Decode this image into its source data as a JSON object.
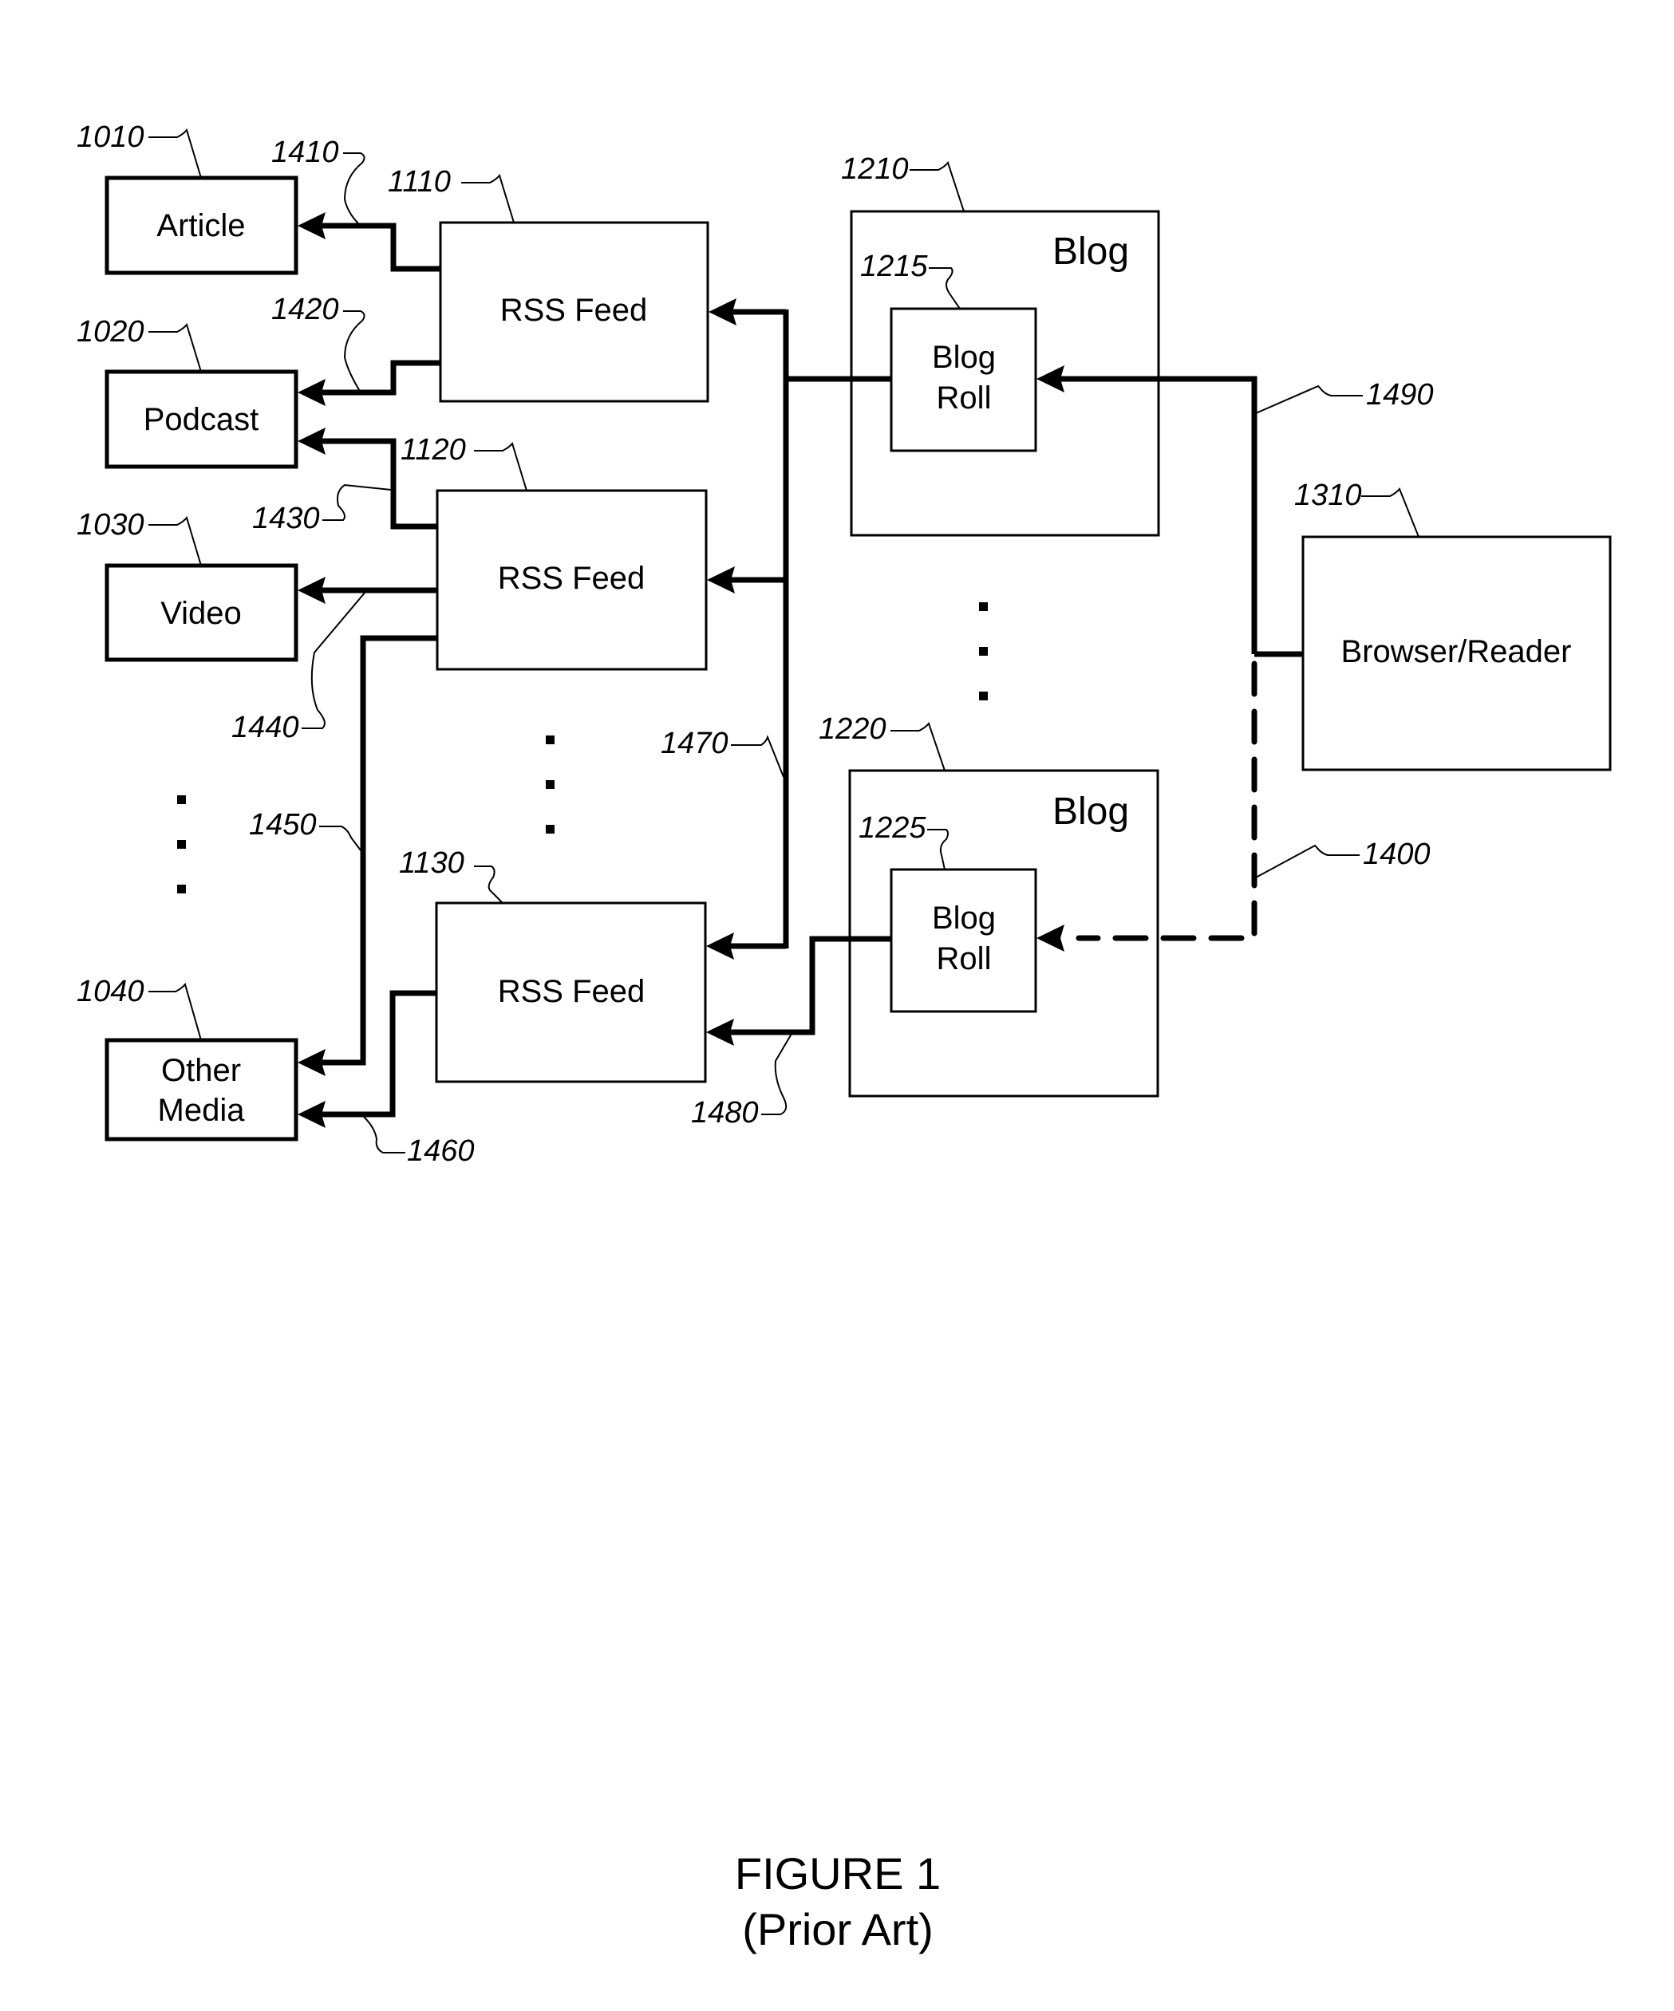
{
  "figure": {
    "title": "FIGURE 1",
    "subtitle": "(Prior Art)"
  },
  "media": {
    "article": {
      "label": "Article",
      "ref": "1010"
    },
    "podcast": {
      "label": "Podcast",
      "ref": "1020"
    },
    "video": {
      "label": "Video",
      "ref": "1030"
    },
    "other": {
      "label_line1": "Other",
      "label_line2": "Media",
      "ref": "1040"
    }
  },
  "feeds": {
    "feed1": {
      "label": "RSS Feed",
      "ref": "1110"
    },
    "feed2": {
      "label": "RSS Feed",
      "ref": "1120"
    },
    "feed3": {
      "label": "RSS Feed",
      "ref": "1130"
    }
  },
  "blogs": {
    "blog1": {
      "label": "Blog",
      "ref": "1210",
      "roll_line1": "Blog",
      "roll_line2": "Roll",
      "roll_ref": "1215"
    },
    "blog2": {
      "label": "Blog",
      "ref": "1220",
      "roll_line1": "Blog",
      "roll_line2": "Roll",
      "roll_ref": "1225"
    }
  },
  "browser": {
    "label": "Browser/Reader",
    "ref": "1310"
  },
  "links": {
    "l1400": "1400",
    "l1410": "1410",
    "l1420": "1420",
    "l1430": "1430",
    "l1440": "1440",
    "l1450": "1450",
    "l1460": "1460",
    "l1470": "1470",
    "l1480": "1480",
    "l1490": "1490"
  }
}
